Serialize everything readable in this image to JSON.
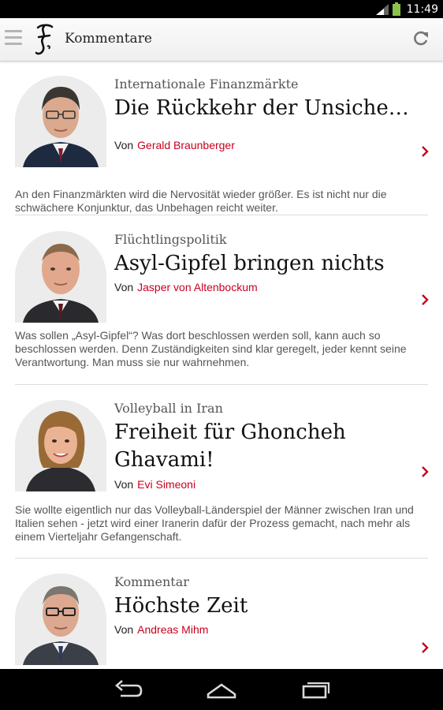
{
  "status_bar": {
    "time": "11:49"
  },
  "app_bar": {
    "title": "Kommentare"
  },
  "articles": [
    {
      "kicker": "Internationale Finanzmärkte",
      "headline": "Die Rückkehr der Unsicherheit",
      "by": "Von",
      "author": "Gerald Braunberger",
      "summary": "An den Finanzmärkten wird die Nervosität wieder größer. Es ist nicht nur die schwächere Konjunktur, das Unbehagen reicht weiter."
    },
    {
      "kicker": "Flüchtlingspolitik",
      "headline": "Asyl-Gipfel bringen nichts",
      "by": "Von",
      "author": "Jasper von Altenbockum",
      "summary": "Was sollen „Asyl-Gipfel“? Was dort beschlossen werden soll, kann auch so beschlossen werden. Denn Zuständigkeiten sind klar geregelt, jeder kennt seine Verantwortung. Man muss sie nur wahrnehmen."
    },
    {
      "kicker": "Volleyball in Iran",
      "headline": "Freiheit für Ghoncheh Ghavami!",
      "by": "Von",
      "author": "Evi Simeoni",
      "summary": "Sie wollte eigentlich nur das Volleyball-Länderspiel der Männer zwischen Iran und Italien sehen - jetzt wird einer Iranerin dafür der Prozess gemacht, nach mehr als einem Vierteljahr Gefangenschaft."
    },
    {
      "kicker": "Kommentar",
      "headline": "Höchste Zeit",
      "by": "Von",
      "author": "Andreas Mihm",
      "summary": ""
    }
  ],
  "colors": {
    "accent": "#c8001e",
    "statusbar": "#000000",
    "appbar": "#f4f4f4"
  }
}
